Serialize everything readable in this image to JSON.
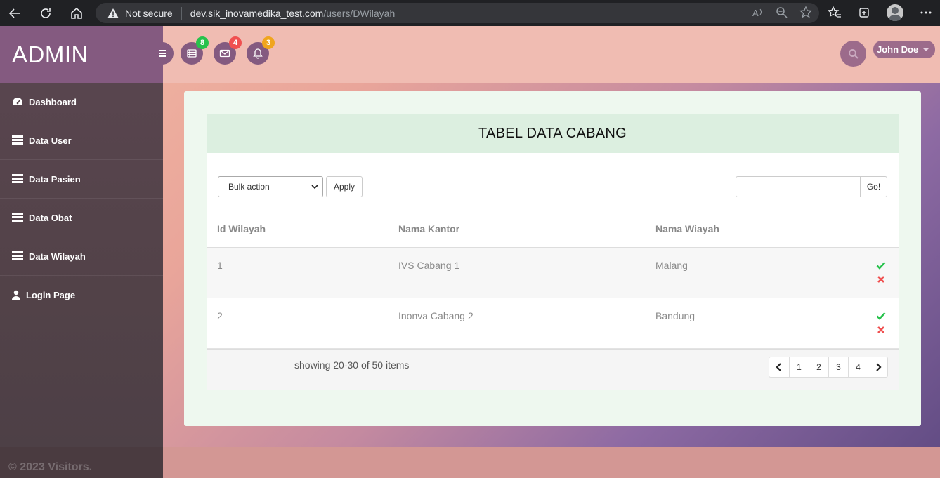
{
  "browser": {
    "not_secure": "Not secure",
    "url_domain": "dev.sik_inovamedika_test.com",
    "url_path": "/users/DWilayah"
  },
  "sidebar": {
    "brand": "ADMIN",
    "items": [
      {
        "label": "Dashboard",
        "icon": "dashboard-icon"
      },
      {
        "label": "Data User",
        "icon": "grid-icon"
      },
      {
        "label": "Data Pasien",
        "icon": "grid-icon"
      },
      {
        "label": "Data Obat",
        "icon": "grid-icon"
      },
      {
        "label": "Data Wilayah",
        "icon": "grid-icon"
      },
      {
        "label": "Login Page",
        "icon": "user-icon"
      }
    ],
    "footer": "© 2023 Visitors."
  },
  "topbar": {
    "badges": {
      "tasks": "8",
      "messages": "4",
      "notifications": "3"
    },
    "badge_colors": {
      "tasks": "#27c24c",
      "messages": "#f05050",
      "notifications": "#f0a51e"
    },
    "user_name": "John Doe"
  },
  "panel": {
    "title": "TABEL DATA CABANG",
    "bulk_action": "Bulk action",
    "apply": "Apply",
    "go": "Go!",
    "columns": [
      "Id Wilayah",
      "Nama Kantor",
      "Nama Wiayah"
    ],
    "rows": [
      {
        "id": "1",
        "kantor": "IVS Cabang 1",
        "wilayah": "Malang"
      },
      {
        "id": "2",
        "kantor": "Inonva Cabang 2",
        "wilayah": "Bandung"
      }
    ],
    "showing": "showing 20-30 of 50 items",
    "pages": [
      "1",
      "2",
      "3",
      "4"
    ]
  },
  "colors": {
    "accent": "#845a80",
    "check": "#27c24c",
    "cross": "#f05050"
  }
}
